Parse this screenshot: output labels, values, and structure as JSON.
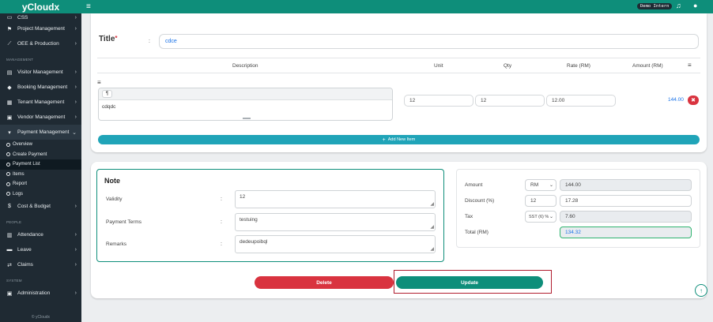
{
  "app": {
    "brand": "yCloudx",
    "mode_badge": "Demo Intern",
    "footer": "© yCloudx"
  },
  "sidebar": {
    "items_top": [
      {
        "label": "CSS",
        "icon": "box-icon"
      },
      {
        "label": "Project Management",
        "icon": "flag-icon"
      },
      {
        "label": "OEE & Production",
        "icon": "chart-icon"
      }
    ],
    "section_management": "MANAGEMENT",
    "items_mgmt": [
      {
        "label": "Visitor Management",
        "icon": "id-card-icon"
      },
      {
        "label": "Booking Management",
        "icon": "tag-icon"
      },
      {
        "label": "Tenant Management",
        "icon": "building-icon"
      },
      {
        "label": "Vendor Management",
        "icon": "vendor-icon"
      },
      {
        "label": "Payment Management",
        "icon": "cart-icon"
      }
    ],
    "payment_sub": [
      {
        "label": "Overview"
      },
      {
        "label": "Create Payment"
      },
      {
        "label": "Payment List"
      },
      {
        "label": "Items"
      },
      {
        "label": "Report"
      },
      {
        "label": "Logs"
      }
    ],
    "cost_budget": "Cost & Budget",
    "section_people": "PEOPLE",
    "items_people": [
      {
        "label": "Attendance",
        "icon": "calendar-icon"
      },
      {
        "label": "Leave",
        "icon": "briefcase-icon"
      },
      {
        "label": "Claims",
        "icon": "exchange-icon"
      }
    ],
    "section_system": "SYSTEM",
    "administration": "Administration"
  },
  "form": {
    "title_label": "Title",
    "title_required": "*",
    "colon": ":",
    "title_value": "cdce",
    "table_headers": {
      "description": "Description",
      "unit": "Unit",
      "qty": "Qty",
      "rate": "Rate (RM)",
      "amount": "Amount (RM)"
    },
    "row": {
      "editor_btn": "¶",
      "description": "cdqdc",
      "unit": "12",
      "qty": "12",
      "rate": "12.00",
      "amount": "144.00"
    },
    "add_item": "Add New Item"
  },
  "note": {
    "title": "Note",
    "validity_label": "Validity",
    "validity_value": "12",
    "terms_label": "Payment Terms",
    "terms_value": "testuing",
    "remarks_label": "Remarks",
    "remarks_value": "dedeupoibql"
  },
  "summary": {
    "amount_label": "Amount",
    "currency": "RM",
    "amount_value": "144.00",
    "discount_label": "Discount (%)",
    "discount_pct": "12",
    "discount_value": "17.28",
    "tax_label": "Tax",
    "tax_option": "SST (6) %",
    "tax_value": "7.60",
    "total_label": "Total (RM)",
    "total_value": "134.32"
  },
  "actions": {
    "delete": "Delete",
    "update": "Update"
  },
  "colors": {
    "brand": "#0e8e7a",
    "sidebar": "#1f2a33",
    "danger": "#d9333f",
    "accent": "#20a4b8"
  }
}
